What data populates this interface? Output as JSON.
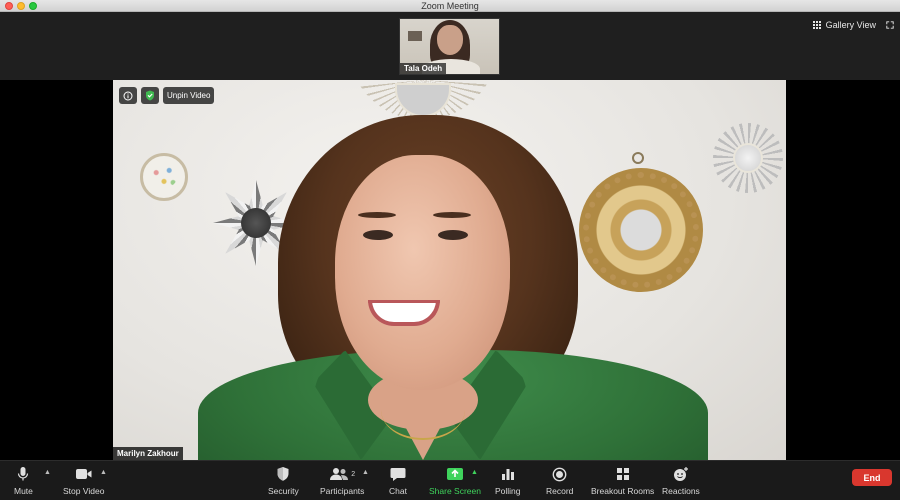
{
  "window": {
    "title": "Zoom Meeting"
  },
  "top_strip": {
    "thumbnail_name": "Tala Odeh",
    "view_label": "Gallery View"
  },
  "main_video": {
    "participant_name": "Marilyn Zakhour",
    "unpin_label": "Unpin Video"
  },
  "toolbar": {
    "mute": "Mute",
    "stop_video": "Stop Video",
    "security": "Security",
    "participants": "Participants",
    "participants_count": "2",
    "chat": "Chat",
    "share_screen": "Share Screen",
    "polling": "Polling",
    "record": "Record",
    "breakout_rooms": "Breakout Rooms",
    "reactions": "Reactions",
    "end": "End"
  },
  "colors": {
    "end_button": "#d9372e",
    "share_screen_accent": "#3fd35c",
    "security_shield": "#3fb950"
  }
}
